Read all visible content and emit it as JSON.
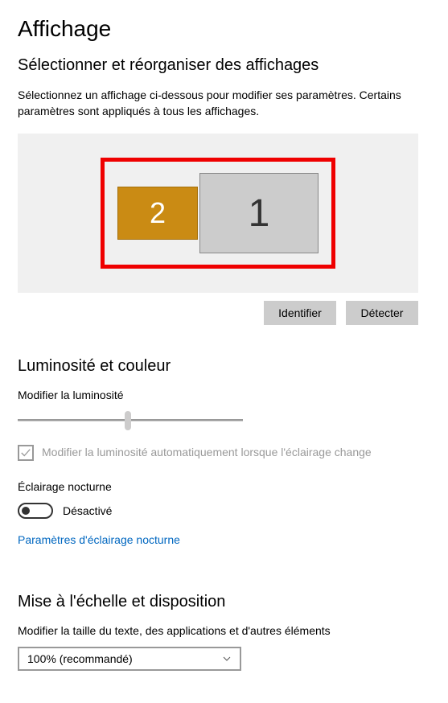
{
  "page": {
    "title": "Affichage"
  },
  "arrange": {
    "title": "Sélectionner et réorganiser des affichages",
    "description": "Sélectionnez un affichage ci-dessous pour modifier ses paramètres. Certains paramètres sont appliqués à tous les affichages.",
    "monitor2_label": "2",
    "monitor1_label": "1",
    "identify_button": "Identifier",
    "detect_button": "Détecter"
  },
  "brightness": {
    "title": "Luminosité et couleur",
    "slider_label": "Modifier la luminosité",
    "slider_value": 50,
    "auto_checkbox_label": "Modifier la luminosité automatiquement lorsque l'éclairage change",
    "auto_checked": true,
    "night_light_label": "Éclairage nocturne",
    "night_light_state": "Désactivé",
    "night_light_on": false,
    "night_light_link": "Paramètres d'éclairage nocturne"
  },
  "scale": {
    "title": "Mise à l'échelle et disposition",
    "text_size_label": "Modifier la taille du texte, des applications et d'autres éléments",
    "dropdown_value": "100% (recommandé)"
  }
}
